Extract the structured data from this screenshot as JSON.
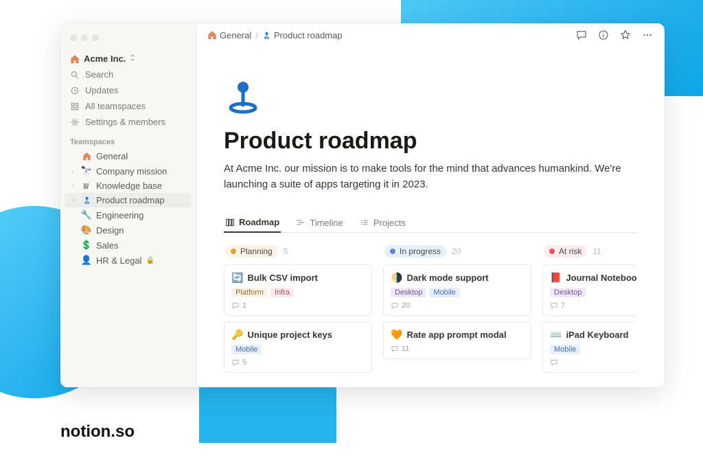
{
  "brand": "notion.so",
  "workspace": {
    "name": "Acme Inc."
  },
  "sidebar": {
    "nav": [
      {
        "label": "Search"
      },
      {
        "label": "Updates"
      },
      {
        "label": "All teamspaces"
      },
      {
        "label": "Settings & members"
      }
    ],
    "section": "Teamspaces",
    "pages": [
      {
        "label": "General",
        "emoji": "home"
      },
      {
        "label": "Company mission",
        "emoji": "binoculars"
      },
      {
        "label": "Knowledge base",
        "emoji": "library"
      },
      {
        "label": "Product roadmap",
        "emoji": "pin"
      },
      {
        "label": "Engineering",
        "emoji": "wrench"
      },
      {
        "label": "Design",
        "emoji": "palette"
      },
      {
        "label": "Sales",
        "emoji": "dollar"
      },
      {
        "label": "HR & Legal",
        "emoji": "person",
        "locked": true
      }
    ]
  },
  "breadcrumbs": [
    {
      "label": "General"
    },
    {
      "label": "Product roadmap"
    }
  ],
  "page": {
    "title": "Product roadmap",
    "description": "At Acme Inc. our mission is to make tools for the mind that advances humankind. We're launching a suite of apps targeting it in 2023."
  },
  "tabs": [
    {
      "label": "Roadmap"
    },
    {
      "label": "Timeline"
    },
    {
      "label": "Projects"
    }
  ],
  "board": {
    "columns": [
      {
        "status": "Planning",
        "class": "planning",
        "count": "5",
        "cards": [
          {
            "icon": "🔄",
            "title": "Bulk CSV import",
            "tags": [
              {
                "label": "Platform",
                "cls": "tag-platform"
              },
              {
                "label": "Infra",
                "cls": "tag-infra"
              }
            ],
            "comments": "1"
          },
          {
            "icon": "🔑",
            "title": "Unique project keys",
            "tags": [
              {
                "label": "Mobile",
                "cls": "tag-mobile"
              }
            ],
            "comments": "5"
          }
        ]
      },
      {
        "status": "In progress",
        "class": "inprogress",
        "count": "20",
        "cards": [
          {
            "icon": "🌗",
            "title": "Dark mode support",
            "tags": [
              {
                "label": "Desktop",
                "cls": "tag-desktop"
              },
              {
                "label": "Mobile",
                "cls": "tag-mobile"
              }
            ],
            "comments": "20"
          },
          {
            "icon": "🧡",
            "title": "Rate app prompt modal",
            "tags": [],
            "comments": "11"
          }
        ]
      },
      {
        "status": "At risk",
        "class": "atrisk",
        "count": "11",
        "cards": [
          {
            "icon": "📕",
            "title": "Journal Notebook",
            "tags": [
              {
                "label": "Desktop",
                "cls": "tag-desktop"
              }
            ],
            "comments": "7"
          },
          {
            "icon": "⌨️",
            "title": "iPad Keyboard",
            "tags": [
              {
                "label": "Mobile",
                "cls": "tag-mobile"
              }
            ],
            "comments": ""
          }
        ]
      }
    ]
  }
}
